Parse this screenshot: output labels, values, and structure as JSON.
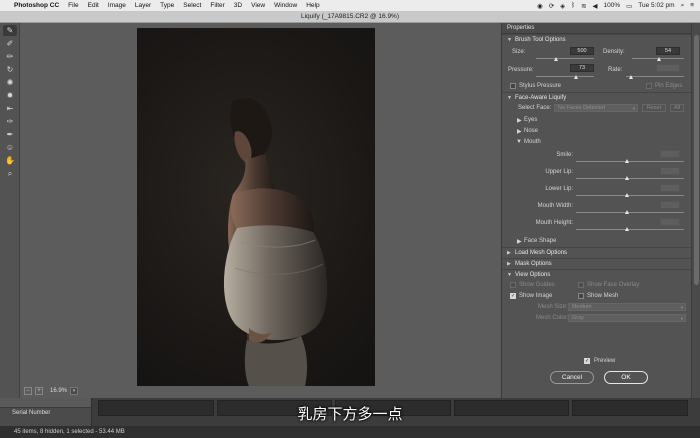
{
  "menubar": {
    "apple_icon": "",
    "app_name": "Photoshop CC",
    "items": [
      "File",
      "Edit",
      "Image",
      "Layer",
      "Type",
      "Select",
      "Filter",
      "3D",
      "View",
      "Window",
      "Help"
    ],
    "battery": "100%",
    "clock": "Tue 5:02 pm"
  },
  "window": {
    "title": "Liquify (_17A9815.CR2 @ 16.9%)"
  },
  "tools": [
    "forward-warp-tool",
    "reconstruct-tool",
    "smooth-tool",
    "twirl-tool",
    "pucker-tool",
    "bloat-tool",
    "push-left-tool",
    "freeze-mask-tool",
    "thaw-mask-tool",
    "face-tool",
    "hand-tool",
    "zoom-tool"
  ],
  "canvas": {
    "zoom": "16.9%",
    "zoom_out": "−",
    "zoom_in": "+"
  },
  "properties": {
    "title": "Properties",
    "brush": {
      "header": "Brush Tool Options",
      "size_label": "Size:",
      "size_value": "500",
      "density_label": "Density:",
      "density_value": "54",
      "pressure_label": "Pressure:",
      "pressure_value": "73",
      "rate_label": "Rate:",
      "rate_value": "",
      "stylus_label": "Stylus Pressure",
      "pin_label": "Pin Edges"
    },
    "face": {
      "header": "Face-Aware Liquify",
      "select_face_label": "Select Face:",
      "select_face_value": "No Faces Detected",
      "reset_label": "Reset",
      "all_label": "All",
      "eyes": "Eyes",
      "nose": "Nose",
      "mouth": "Mouth",
      "smile": "Smile:",
      "upper_lip": "Upper Lip:",
      "lower_lip": "Lower Lip:",
      "mouth_width": "Mouth Width:",
      "mouth_height": "Mouth Height:",
      "face_shape": "Face Shape"
    },
    "load_mesh": "Load Mesh Options",
    "mask": "Mask Options",
    "view": {
      "header": "View Options",
      "show_guides": "Show Guides",
      "show_face_overlay": "Show Face Overlay",
      "show_image": "Show Image",
      "show_mesh": "Show Mesh",
      "mesh_size_label": "Mesh Size:",
      "mesh_size_value": "Medium",
      "mesh_color_label": "Mesh Color:",
      "mesh_color_value": "Gray"
    },
    "preview_label": "Preview",
    "cancel_label": "Cancel",
    "ok_label": "OK"
  },
  "bridge": {
    "serial_label": "Serial Number",
    "status": "45 items, 8 hidden, 1 selected - 53.44 MB"
  },
  "subtitle": "乳房下方多一点"
}
